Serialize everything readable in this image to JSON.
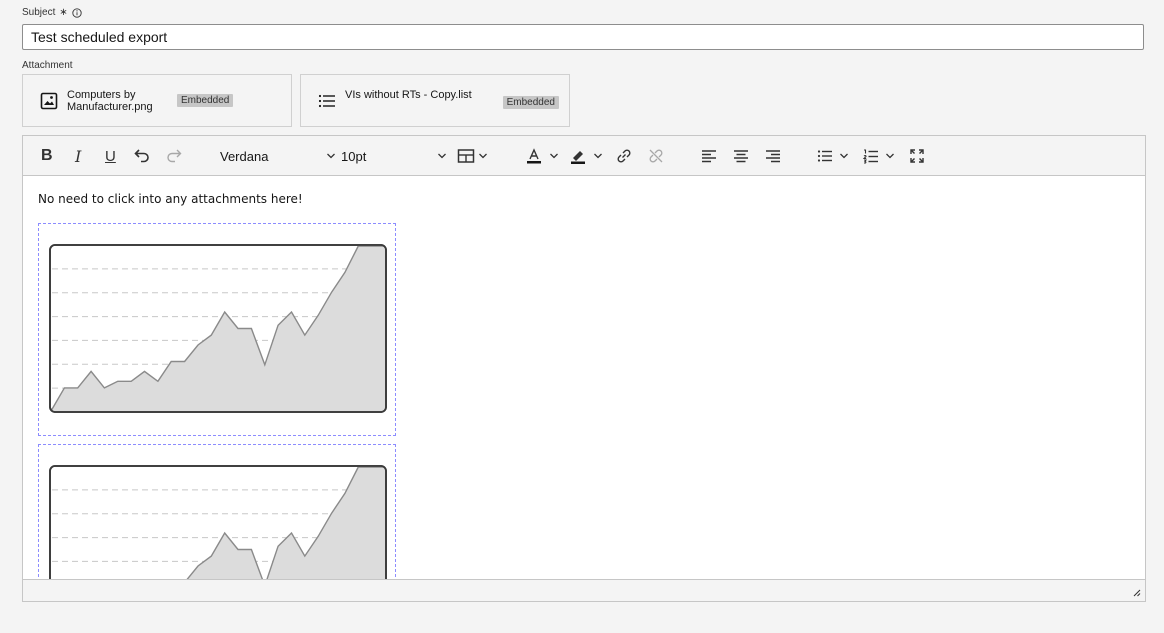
{
  "subject": {
    "label": "Subject",
    "required_mark": "∗",
    "value": "Test scheduled export"
  },
  "attachments": {
    "label": "Attachment",
    "items": [
      {
        "name": "Computers by Manufacturer.png",
        "badge": "Embedded",
        "icon": "image-icon"
      },
      {
        "name": "VIs without RTs - Copy.list",
        "badge": "Embedded",
        "icon": "list-icon"
      }
    ]
  },
  "toolbar": {
    "bold": "B",
    "italic": "I",
    "underline": "U",
    "font_family": "Verdana",
    "font_size": "10pt"
  },
  "editor": {
    "paragraph": "No need to click into any attachments here!",
    "embedded_images": 2
  },
  "chart_data": {
    "type": "area",
    "x": [
      0,
      1,
      2,
      3,
      4,
      5,
      6,
      7,
      8,
      9,
      10,
      11,
      12,
      13,
      14,
      15,
      16,
      17,
      18,
      19,
      20,
      21,
      22,
      23,
      24,
      25
    ],
    "values": [
      0,
      14,
      14,
      24,
      14,
      18,
      18,
      24,
      18,
      30,
      30,
      40,
      46,
      60,
      50,
      50,
      28,
      52,
      60,
      46,
      58,
      72,
      84,
      100,
      100,
      100
    ],
    "ylim": [
      0,
      100
    ],
    "grid": true
  }
}
